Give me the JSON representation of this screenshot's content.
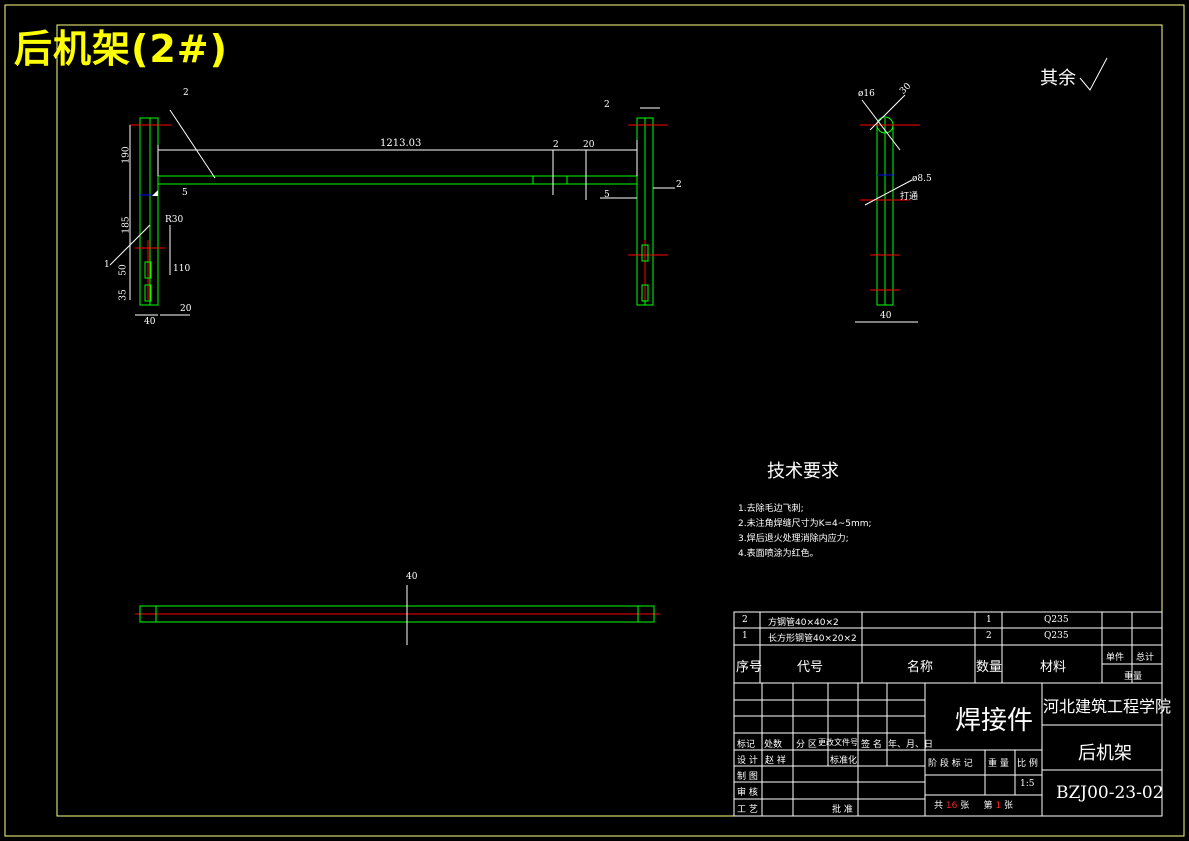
{
  "sheet": {
    "title": "后机架(2#)",
    "surface_note": "其余"
  },
  "dimensions": {
    "front_length": "1213.03",
    "label_2a": "2",
    "label_2b": "2",
    "label_2c": "2",
    "label_2d": "2",
    "dim_20a": "20",
    "dim_5a": "5",
    "dim_5b": "5",
    "dim_190": "190",
    "dim_185": "185",
    "dim_30": "R30",
    "dim_110": "110",
    "dim_50": "50",
    "dim_35": "35",
    "dim_40a": "40",
    "dim_20b": "20",
    "part_1": "1",
    "dia_16": "ø16",
    "dia_30": "30",
    "dia_85": "ø8.5",
    "dia_85_note": "打通",
    "dim_40b": "40",
    "dim_40c": "40"
  },
  "tech": {
    "heading": "技术要求",
    "notes": [
      "1.去除毛边飞刺;",
      "2.未注角焊缝尺寸为K=4~5mm;",
      "3.焊后退火处理消除内应力;",
      "4.表面喷涂为红色。"
    ]
  },
  "bom": {
    "rows": [
      {
        "no": "2",
        "name": "方钢管40×40×2",
        "qty": "1",
        "material": "Q235"
      },
      {
        "no": "1",
        "name": "长方形钢管40×20×2",
        "qty": "2",
        "material": "Q235"
      }
    ],
    "headers": {
      "no": "序号",
      "code": "代号",
      "name": "名称",
      "qty": "数量",
      "material": "材料",
      "unit": "单件",
      "total": "总计",
      "weight": "重量"
    }
  },
  "titleblock": {
    "type": "焊接件",
    "school": "河北建筑工程学院",
    "part_name": "后机架",
    "drawing_no": "BZJ00-23-02",
    "scale": "1:5",
    "row_labels": {
      "mark": "标记",
      "count": "处数",
      "zone": "分 区",
      "change_doc": "更改文件号",
      "sign": "签 名",
      "date": "年、月、日",
      "design": "设 计",
      "designer": "赵 祥",
      "standard": "标准化",
      "draw": "制 图",
      "check": "审 核",
      "process": "工 艺",
      "approve": "批 准",
      "stage": "阶 段 标 记",
      "weight": "重 量",
      "ratio": "比 例"
    },
    "sheets_total_label": "共",
    "sheets_total": "16",
    "sheets_unit": "张",
    "sheet_no_label": "第",
    "sheet_no": "1",
    "sheet_unit2": "张"
  },
  "colors": {
    "border": "#ffff80",
    "geometry": "#00ff00",
    "dimension": "#ffffff",
    "centerline": "#ff0000",
    "hidden": "#0000ff",
    "title": "#ffff00"
  }
}
